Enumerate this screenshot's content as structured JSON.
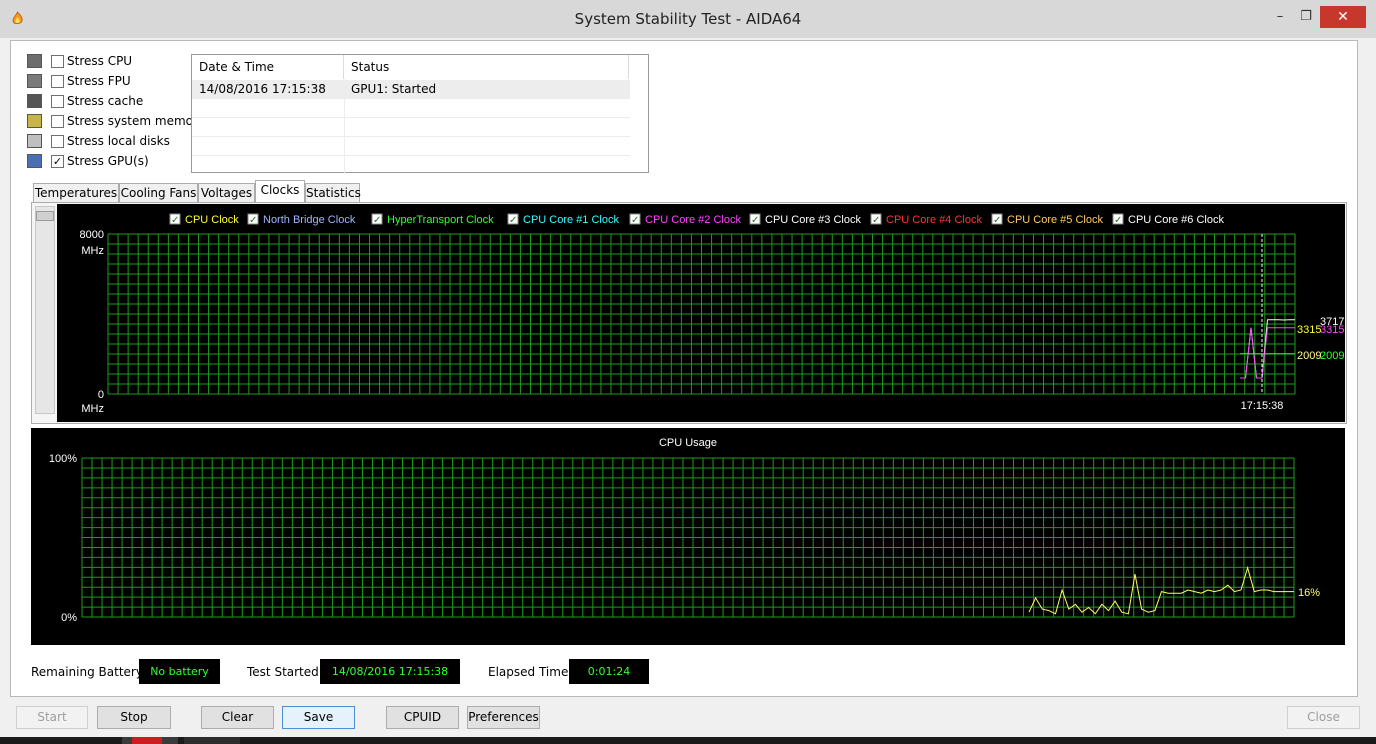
{
  "window": {
    "title": "System Stability Test - AIDA64",
    "min_glyph": "–",
    "max_glyph": "❐",
    "close_glyph": "✕"
  },
  "stress": [
    {
      "label": "Stress CPU",
      "checked": false,
      "icon": "cpu-icon"
    },
    {
      "label": "Stress FPU",
      "checked": false,
      "icon": "fpu-icon"
    },
    {
      "label": "Stress cache",
      "checked": false,
      "icon": "cache-icon"
    },
    {
      "label": "Stress system memory",
      "checked": false,
      "icon": "memory-icon"
    },
    {
      "label": "Stress local disks",
      "checked": false,
      "icon": "disk-icon"
    },
    {
      "label": "Stress GPU(s)",
      "checked": true,
      "icon": "gpu-icon"
    }
  ],
  "log": {
    "col_datetime": "Date & Time",
    "col_status": "Status",
    "rows": [
      {
        "datetime": "14/08/2016 17:15:38",
        "status": "GPU1: Started"
      }
    ]
  },
  "tabs": [
    "Temperatures",
    "Cooling Fans",
    "Voltages",
    "Clocks",
    "Statistics"
  ],
  "active_tab": "Clocks",
  "clock_chart": {
    "legend": [
      {
        "name": "CPU Clock",
        "color": "#ffff33",
        "checked": true
      },
      {
        "name": "North Bridge Clock",
        "color": "#9fb6ff",
        "checked": true
      },
      {
        "name": "HyperTransport Clock",
        "color": "#33ff33",
        "checked": true
      },
      {
        "name": "CPU Core #1 Clock",
        "color": "#33ffff",
        "checked": true
      },
      {
        "name": "CPU Core #2 Clock",
        "color": "#ff44ff",
        "checked": true
      },
      {
        "name": "CPU Core #3 Clock",
        "color": "#ffffff",
        "checked": true
      },
      {
        "name": "CPU Core #4 Clock",
        "color": "#ff3333",
        "checked": true
      },
      {
        "name": "CPU Core #5 Clock",
        "color": "#ffcc66",
        "checked": true
      },
      {
        "name": "CPU Core #6 Clock",
        "color": "#ffffff",
        "checked": true
      }
    ],
    "y_max_label": "8000",
    "y_min_label": "0",
    "unit": "MHz",
    "time_label": "17:15:38",
    "value_labels": {
      "v3717": "3717",
      "v3315a": "3315",
      "v3315b": "3315",
      "v2009a": "2009",
      "v2009b": "2009"
    },
    "grid_color": "#1a9e1a"
  },
  "usage_chart": {
    "title": "CPU Usage",
    "y_max_label": "100%",
    "y_min_label": "0%",
    "current_label": "16%",
    "line_color": "#ffff66"
  },
  "chart_data": [
    {
      "type": "line",
      "title": "",
      "ylabel": "MHz",
      "ylim": [
        0,
        8000
      ],
      "series": [
        {
          "name": "CPU Clock",
          "values": [
            800,
            800,
            3315,
            800,
            800,
            3717,
            3717,
            3717,
            3700,
            3717,
            3717
          ]
        },
        {
          "name": "CPU Core #2 Clock",
          "values": [
            800,
            800,
            3315,
            800,
            800,
            3315,
            3315,
            3315,
            3315,
            3315,
            3315
          ]
        },
        {
          "name": "HyperTransport Clock",
          "values": [
            2009,
            2009,
            2009,
            2009,
            2009,
            2009,
            2009,
            2009,
            2009,
            2009,
            2009
          ]
        }
      ],
      "annotations": [
        "3717",
        "3315",
        "3315",
        "2009",
        "2009",
        "17:15:38"
      ]
    },
    {
      "type": "line",
      "title": "CPU Usage",
      "ylabel": "",
      "ylim": [
        0,
        100
      ],
      "series": [
        {
          "name": "CPU Usage",
          "values": [
            3,
            12,
            5,
            4,
            2,
            17,
            5,
            8,
            3,
            6,
            2,
            8,
            4,
            10,
            3,
            2,
            27,
            5,
            3,
            4,
            16,
            15,
            15,
            15,
            17,
            16,
            15,
            17,
            16,
            17,
            20,
            16,
            17,
            31,
            16,
            17,
            17,
            16,
            16,
            16,
            16
          ]
        }
      ],
      "annotations": [
        "16%"
      ]
    }
  ],
  "status": {
    "battery_label": "Remaining Battery:",
    "battery_value": "No battery",
    "started_label": "Test Started:",
    "started_value": "14/08/2016 17:15:38",
    "elapsed_label": "Elapsed Time:",
    "elapsed_value": "0:01:24"
  },
  "buttons": {
    "start": "Start",
    "stop": "Stop",
    "clear": "Clear",
    "save": "Save",
    "cpuid": "CPUID",
    "preferences": "Preferences",
    "close": "Close"
  }
}
